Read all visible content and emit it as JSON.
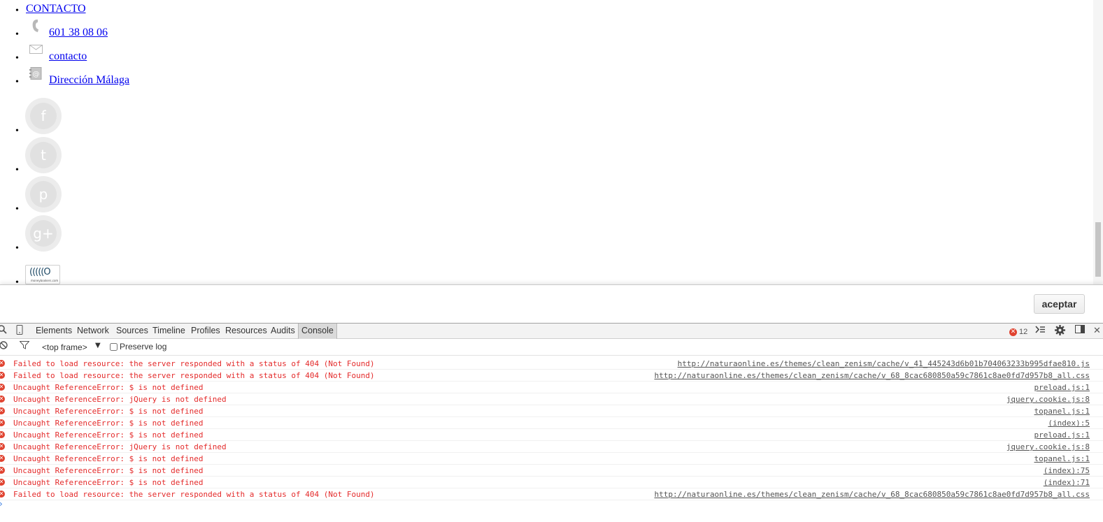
{
  "page": {
    "nav": {
      "contact_label": "CONTACTO",
      "phone_label": "601 38 08 06",
      "email_label": "contacto",
      "address_label": "Dirección Málaga"
    },
    "social": [
      {
        "name": "facebook-icon",
        "glyph": "f"
      },
      {
        "name": "twitter-icon",
        "glyph": "t"
      },
      {
        "name": "pinterest-icon",
        "glyph": "p"
      },
      {
        "name": "googleplus-icon",
        "glyph": "g+"
      }
    ],
    "badge": {
      "mark": "(((((O",
      "text": "moneybookers.com"
    }
  },
  "cookie_bar": {
    "accept_label": "aceptar"
  },
  "devtools": {
    "tabs": [
      {
        "label": "Elements"
      },
      {
        "label": "Network"
      },
      {
        "label": "Sources"
      },
      {
        "label": "Timeline"
      },
      {
        "label": "Profiles"
      },
      {
        "label": "Resources"
      },
      {
        "label": "Audits"
      },
      {
        "label": "Console",
        "active": true
      }
    ],
    "error_count": "12",
    "frame": "<top frame>",
    "preserve_log_label": "Preserve log",
    "preserve_log_checked": false,
    "messages": [
      {
        "text": "Failed to load resource: the server responded with a status of 404 (Not Found)",
        "source": "http://naturaonline.es/themes/clean_zenism/cache/v_41_445243d6b01b704063233b995dfae810.js"
      },
      {
        "text": "Failed to load resource: the server responded with a status of 404 (Not Found)",
        "source": "http://naturaonline.es/themes/clean_zenism/cache/v_68_8cac680850a59c7861c8ae0fd7d957b8_all.css"
      },
      {
        "text": "Uncaught ReferenceError: $ is not defined",
        "source": "preload.js:1"
      },
      {
        "text": "Uncaught ReferenceError: jQuery is not defined",
        "source": "jquery.cookie.js:8"
      },
      {
        "text": "Uncaught ReferenceError: $ is not defined",
        "source": "topanel.js:1"
      },
      {
        "text": "Uncaught ReferenceError: $ is not defined",
        "source": "(index):5"
      },
      {
        "text": "Uncaught ReferenceError: $ is not defined",
        "source": "preload.js:1"
      },
      {
        "text": "Uncaught ReferenceError: jQuery is not defined",
        "source": "jquery.cookie.js:8"
      },
      {
        "text": "Uncaught ReferenceError: $ is not defined",
        "source": "topanel.js:1"
      },
      {
        "text": "Uncaught ReferenceError: $ is not defined",
        "source": "(index):75"
      },
      {
        "text": "Uncaught ReferenceError: $ is not defined",
        "source": "(index):71"
      },
      {
        "text": "Failed to load resource: the server responded with a status of 404 (Not Found)",
        "source": "http://naturaonline.es/themes/clean_zenism/cache/v_68_8cac680850a59c7861c8ae0fd7d957b8_all.css"
      }
    ],
    "prompt_glyph": "›"
  },
  "colors": {
    "link": "#0000ee",
    "error": "#e42b2b",
    "error_icon": "#e0422f"
  }
}
